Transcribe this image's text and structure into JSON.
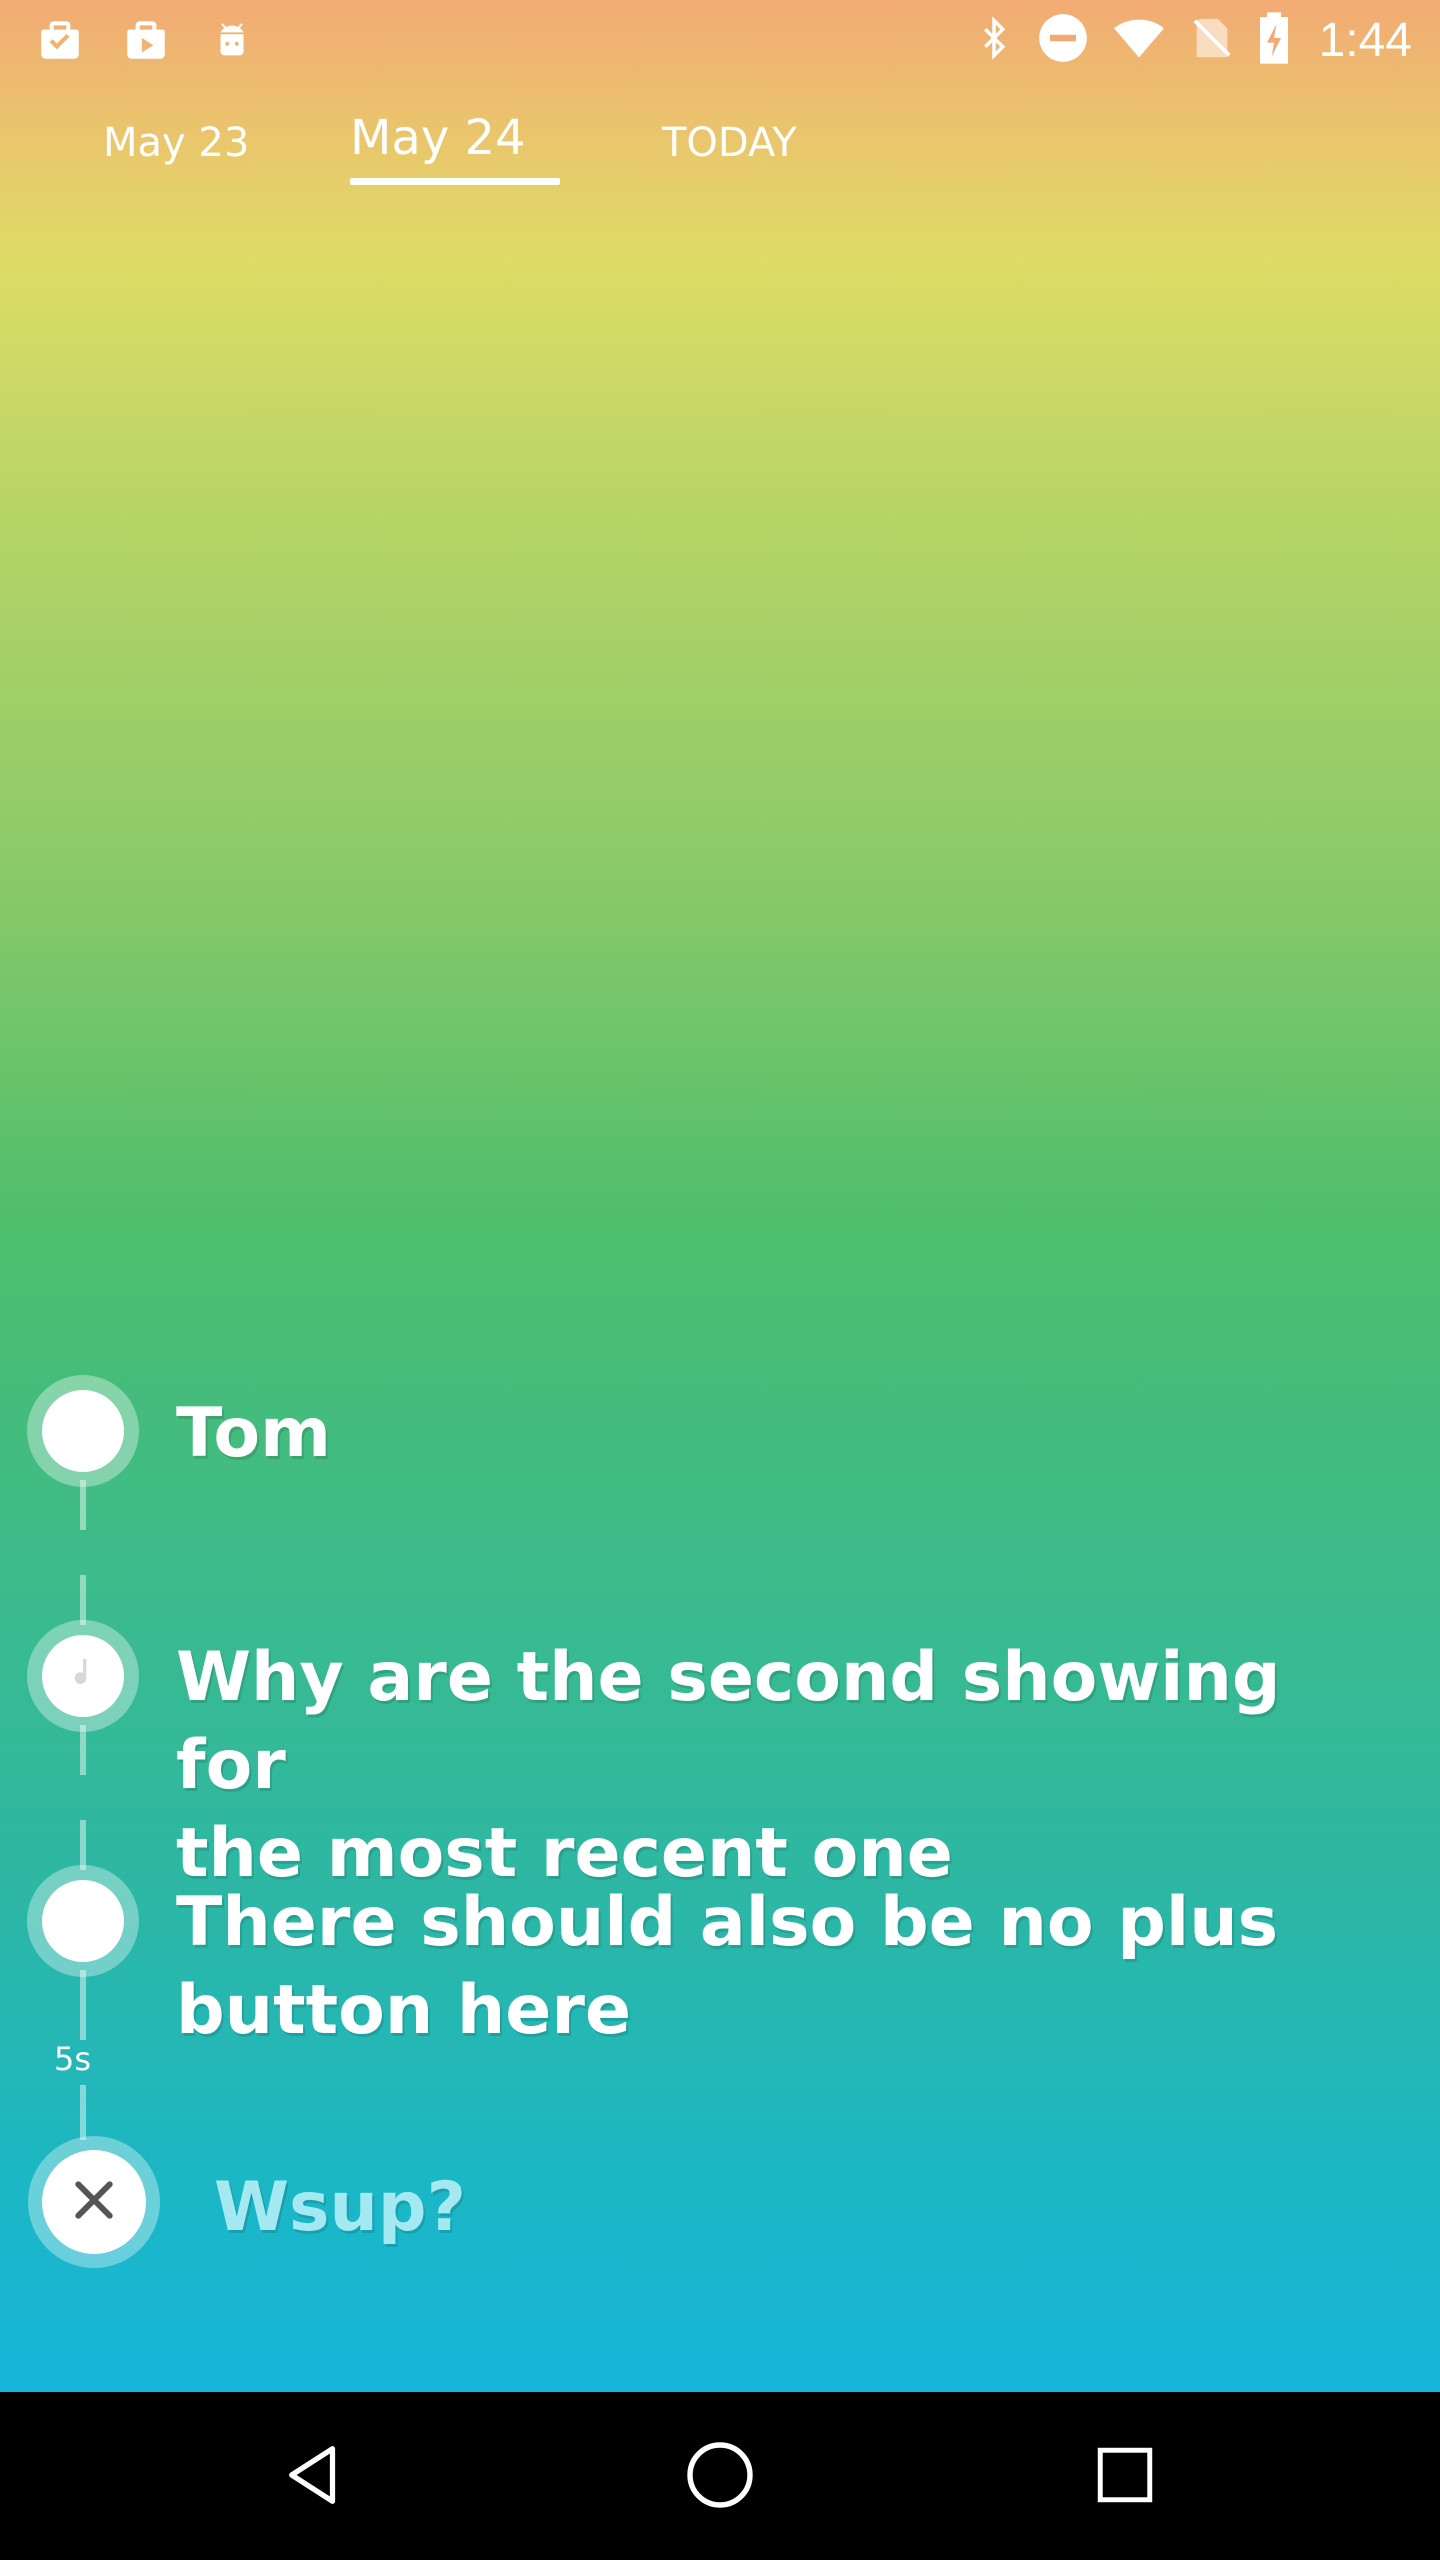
{
  "status_bar": {
    "time": "1:44",
    "left_icons": [
      "clipboard-check-icon",
      "briefcase-play-icon",
      "android-icon"
    ],
    "right_icons": [
      "bluetooth-icon",
      "do-not-disturb-icon",
      "wifi-icon",
      "no-sim-icon",
      "battery-charging-icon"
    ]
  },
  "tabs": [
    {
      "label": "May 23"
    },
    {
      "label": "May 24",
      "selected": true
    },
    {
      "label": "TODAY"
    }
  ],
  "timeline": {
    "items": [
      {
        "text": "Tom",
        "icon": "circle"
      },
      {
        "text": "Why are the second showing for\nthe most recent one",
        "icon": "music-note-icon"
      },
      {
        "text": "There should also be no plus\nbutton here",
        "icon": "circle"
      }
    ],
    "duration": "5s"
  },
  "compose": {
    "placeholder": "Wsup?",
    "icon": "close-icon"
  },
  "nav": [
    "back-icon",
    "home-icon",
    "recents-icon"
  ],
  "colors": {
    "gradient_top": "#f2ab74",
    "gradient_yellow": "#dddc66",
    "gradient_green": "#4dbe6c",
    "gradient_bottom": "#15b5da",
    "text": "#ffffff"
  }
}
